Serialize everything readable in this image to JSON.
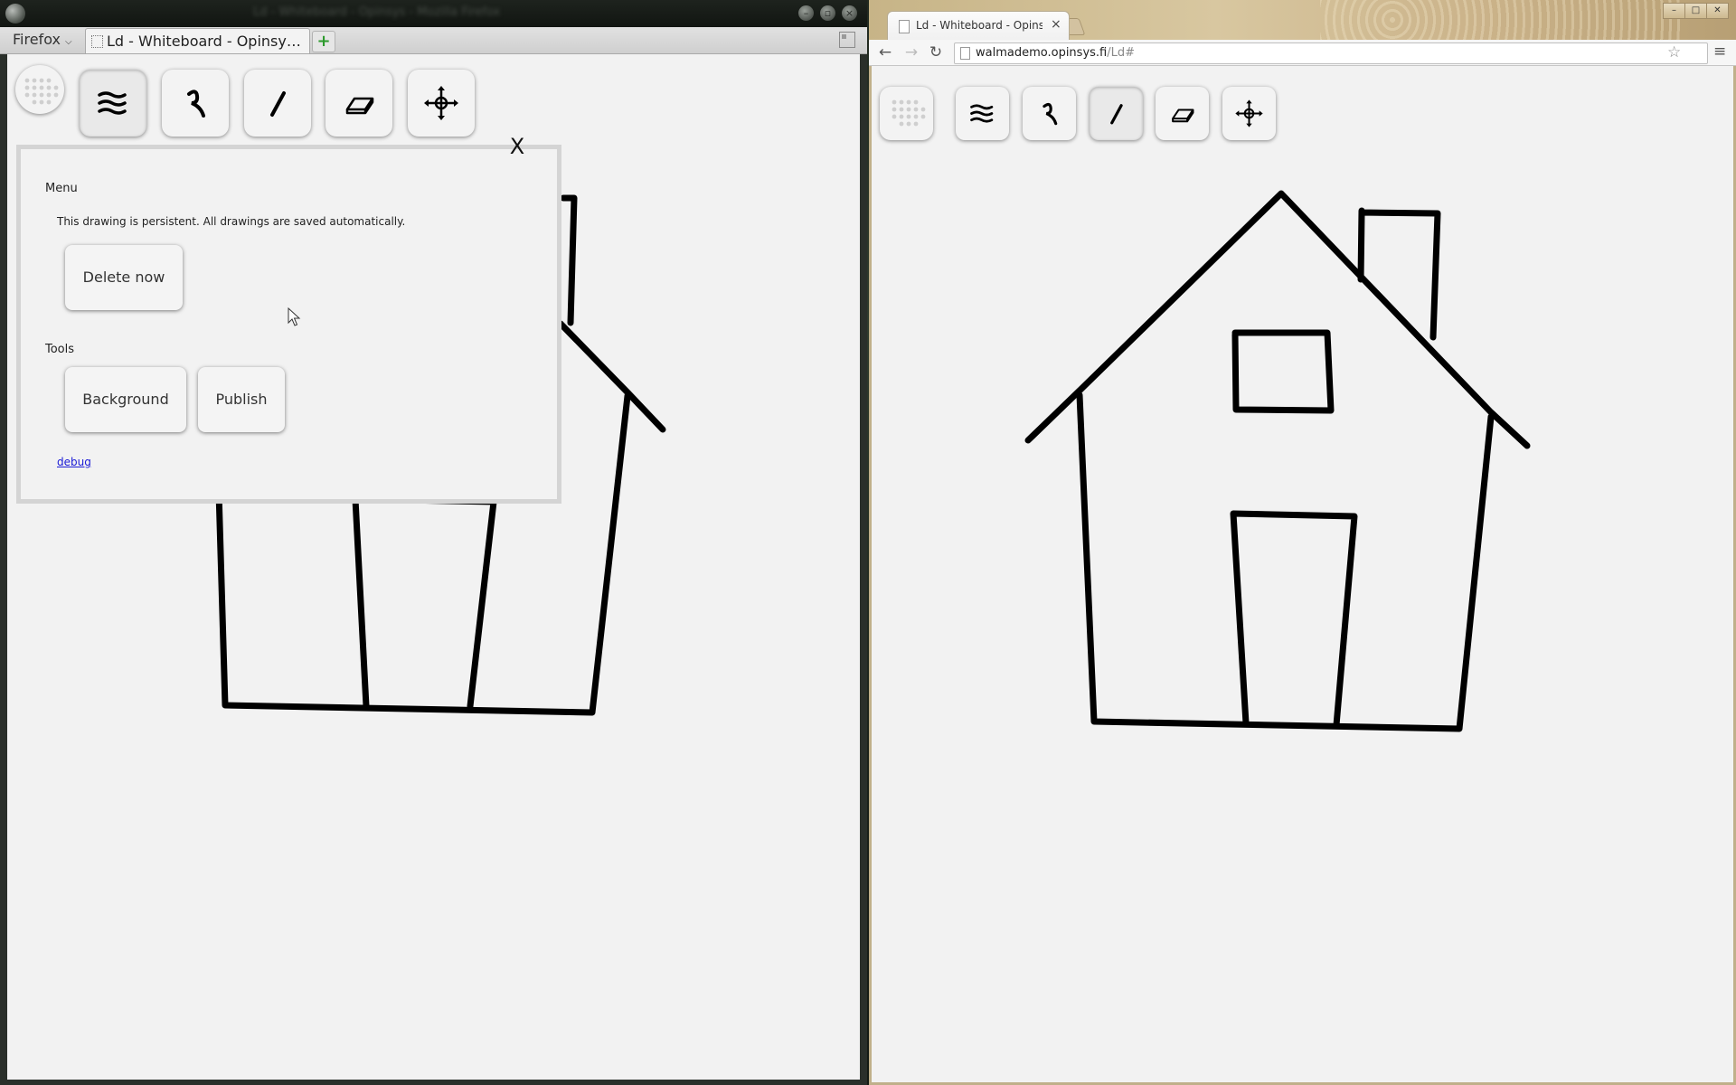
{
  "firefox": {
    "title_bar": "Ld - Whiteboard - Opinsys - Mozilla Firefox",
    "app_menu_label": "Firefox",
    "tab_title": "Ld - Whiteboard - Opinsys ...",
    "new_tab_icon": "plus-icon"
  },
  "chrome": {
    "tab_title": "Ld - Whiteboard - Opinsys",
    "tab_close": "×",
    "url_host": "walmademo.opinsys.fi",
    "url_path": "/Ld#"
  },
  "toolbar": {
    "tools": [
      {
        "name": "apps",
        "icon": "apps-grid-icon"
      },
      {
        "name": "menu",
        "icon": "menu-lines-icon"
      },
      {
        "name": "freehand",
        "icon": "freehand-pen-icon"
      },
      {
        "name": "line",
        "icon": "line-icon"
      },
      {
        "name": "eraser",
        "icon": "eraser-icon"
      },
      {
        "name": "move",
        "icon": "move-arrows-icon"
      }
    ],
    "firefox_active": "menu",
    "chrome_active": "line"
  },
  "menu_panel": {
    "close_label": "X",
    "menu_heading": "Menu",
    "persist_note": "This drawing is persistent. All drawings are saved automatically.",
    "delete_button": "Delete now",
    "tools_heading": "Tools",
    "background_button": "Background",
    "publish_button": "Publish",
    "debug_link": "debug"
  },
  "colors": {
    "canvas": "#f2f2f2",
    "stroke": "#000000",
    "link": "#1a1ad6"
  }
}
